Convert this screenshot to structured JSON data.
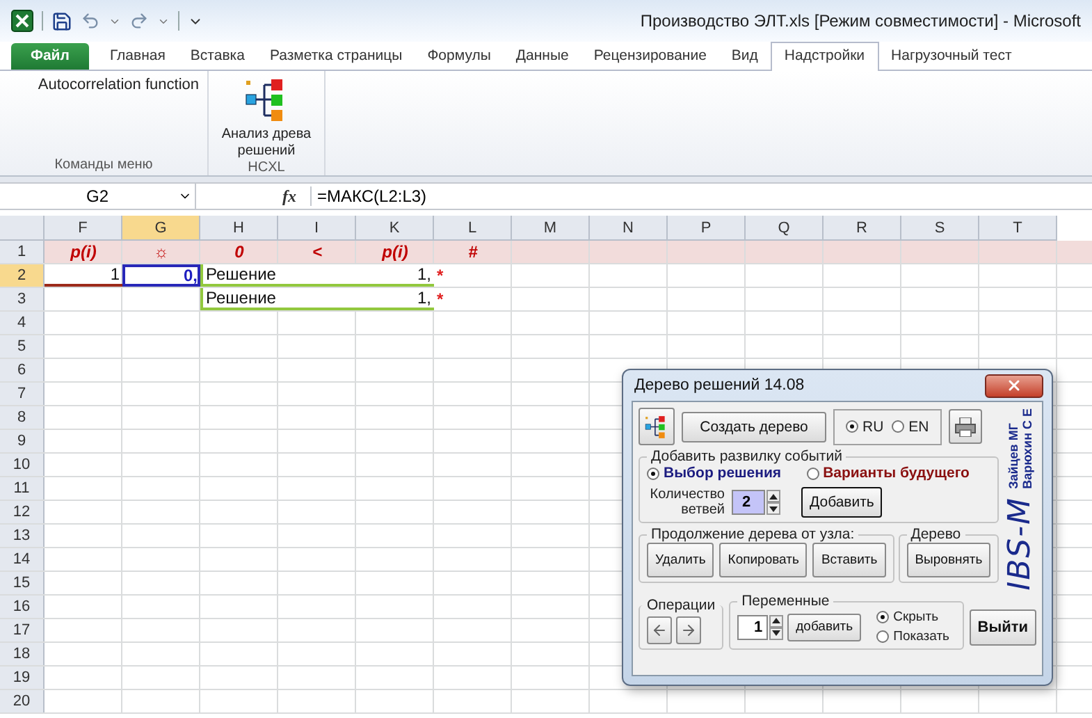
{
  "window": {
    "title": "Производство ЭЛТ.xls [Режим совместимости] - Microsoft"
  },
  "tabs": [
    {
      "label": "Файл",
      "kind": "file",
      "selected": false
    },
    {
      "label": "Главная",
      "kind": "tab",
      "selected": false
    },
    {
      "label": "Вставка",
      "kind": "tab",
      "selected": false
    },
    {
      "label": "Разметка страницы",
      "kind": "tab",
      "selected": false
    },
    {
      "label": "Формулы",
      "kind": "tab",
      "selected": false
    },
    {
      "label": "Данные",
      "kind": "tab",
      "selected": false
    },
    {
      "label": "Рецензирование",
      "kind": "tab",
      "selected": false
    },
    {
      "label": "Вид",
      "kind": "tab",
      "selected": false
    },
    {
      "label": "Надстройки",
      "kind": "tab",
      "selected": true
    },
    {
      "label": "Нагрузочный тест",
      "kind": "tab",
      "selected": false
    }
  ],
  "ribbon": {
    "groups": [
      {
        "label": "Команды меню",
        "buttons": [
          {
            "label": "Autocorrelation function",
            "kind": "text"
          }
        ]
      },
      {
        "label": "HCXL",
        "buttons": [
          {
            "label": "Анализ древа решений",
            "kind": "large-icon"
          }
        ]
      }
    ]
  },
  "formula_bar": {
    "name_box": "G2",
    "function_button": "fx",
    "formula": "=МАКС(L2:L3)"
  },
  "sheet": {
    "columns": [
      {
        "label": "F",
        "selected": false
      },
      {
        "label": "G",
        "selected": true
      },
      {
        "label": "H",
        "selected": false
      },
      {
        "label": "I",
        "selected": false
      },
      {
        "label": "K",
        "selected": false
      },
      {
        "label": "L",
        "selected": false
      },
      {
        "label": "M",
        "selected": false
      },
      {
        "label": "N",
        "selected": false
      },
      {
        "label": "P",
        "selected": false
      },
      {
        "label": "Q",
        "selected": false
      },
      {
        "label": "R",
        "selected": false
      },
      {
        "label": "S",
        "selected": false
      },
      {
        "label": "T",
        "selected": false
      }
    ],
    "rows": [
      {
        "number": "1",
        "selected": false,
        "kind": "band",
        "cells": [
          {
            "text": "p(i)",
            "kind": "label"
          },
          {
            "text": "☼",
            "kind": "label"
          },
          {
            "text": "0",
            "kind": "label"
          },
          {
            "text": "<",
            "kind": "label"
          },
          {
            "text": "p(i)",
            "kind": "label"
          },
          {
            "text": "#",
            "kind": "label"
          },
          {},
          {},
          {},
          {},
          {},
          {},
          {}
        ]
      },
      {
        "number": "2",
        "selected": true,
        "kind": "plain",
        "cells": [
          {
            "text": "1",
            "kind": "value"
          },
          {
            "text": "0,",
            "kind": "result",
            "selected": true
          },
          {
            "text": "Решение",
            "value": "1,",
            "kind": "branch"
          },
          {
            "text": "*",
            "kind": "marker"
          },
          {},
          {},
          {},
          {},
          {},
          {},
          {}
        ]
      },
      {
        "number": "3",
        "selected": false,
        "kind": "plain",
        "cells": [
          {},
          {},
          {
            "text": "Решение",
            "value": "1,",
            "kind": "branch"
          },
          {
            "text": "*",
            "kind": "marker"
          },
          {},
          {},
          {},
          {},
          {},
          {},
          {}
        ]
      },
      {
        "number": "4",
        "selected": false,
        "kind": "plain"
      },
      {
        "number": "5",
        "selected": false,
        "kind": "plain"
      },
      {
        "number": "6",
        "selected": false,
        "kind": "plain"
      },
      {
        "number": "7",
        "selected": false,
        "kind": "plain"
      },
      {
        "number": "8",
        "selected": false,
        "kind": "plain"
      },
      {
        "number": "9",
        "selected": false,
        "kind": "plain"
      },
      {
        "number": "10",
        "selected": false,
        "kind": "plain"
      },
      {
        "number": "11",
        "selected": false,
        "kind": "plain"
      },
      {
        "number": "12",
        "selected": false,
        "kind": "plain"
      },
      {
        "number": "13",
        "selected": false,
        "kind": "plain"
      },
      {
        "number": "14",
        "selected": false,
        "kind": "plain"
      },
      {
        "number": "15",
        "selected": false,
        "kind": "plain"
      },
      {
        "number": "16",
        "selected": false,
        "kind": "plain"
      },
      {
        "number": "17",
        "selected": false,
        "kind": "plain"
      },
      {
        "number": "18",
        "selected": false,
        "kind": "plain"
      },
      {
        "number": "19",
        "selected": false,
        "kind": "plain"
      },
      {
        "number": "20",
        "selected": false,
        "kind": "plain"
      }
    ]
  },
  "dialog": {
    "title": "Дерево решений 14.08",
    "create_button": "Создать дерево",
    "language": [
      {
        "label": "RU",
        "selected": true
      },
      {
        "label": "EN",
        "selected": false
      }
    ],
    "add_fork": {
      "legend": "Добавить  развилку событий",
      "options": [
        {
          "label": "Выбор решения",
          "selected": true,
          "color": "#1c1c80"
        },
        {
          "label": "Варианты будущего",
          "selected": false,
          "color": "#8a1010"
        }
      ],
      "count_label": "Количество ветвей",
      "count_value": "2",
      "add_button": "Добавить"
    },
    "continue": {
      "legend": "Продолжение дерева от узла:",
      "buttons": [
        "Удалить",
        "Копировать",
        "Вставить"
      ]
    },
    "tree": {
      "legend": "Дерево",
      "buttons": [
        "Выровнять"
      ]
    },
    "operations": {
      "legend": "Операции"
    },
    "variables": {
      "legend": "Переменные",
      "value": "1",
      "add_button": "добавить",
      "visibility": [
        {
          "label": "Скрыть",
          "selected": true
        },
        {
          "label": "Показать",
          "selected": false
        }
      ]
    },
    "exit_button": "Выйти",
    "logo": {
      "title": "IBS-M",
      "authors": [
        "Зайцев МГ",
        "Варюхин С Е"
      ]
    }
  }
}
